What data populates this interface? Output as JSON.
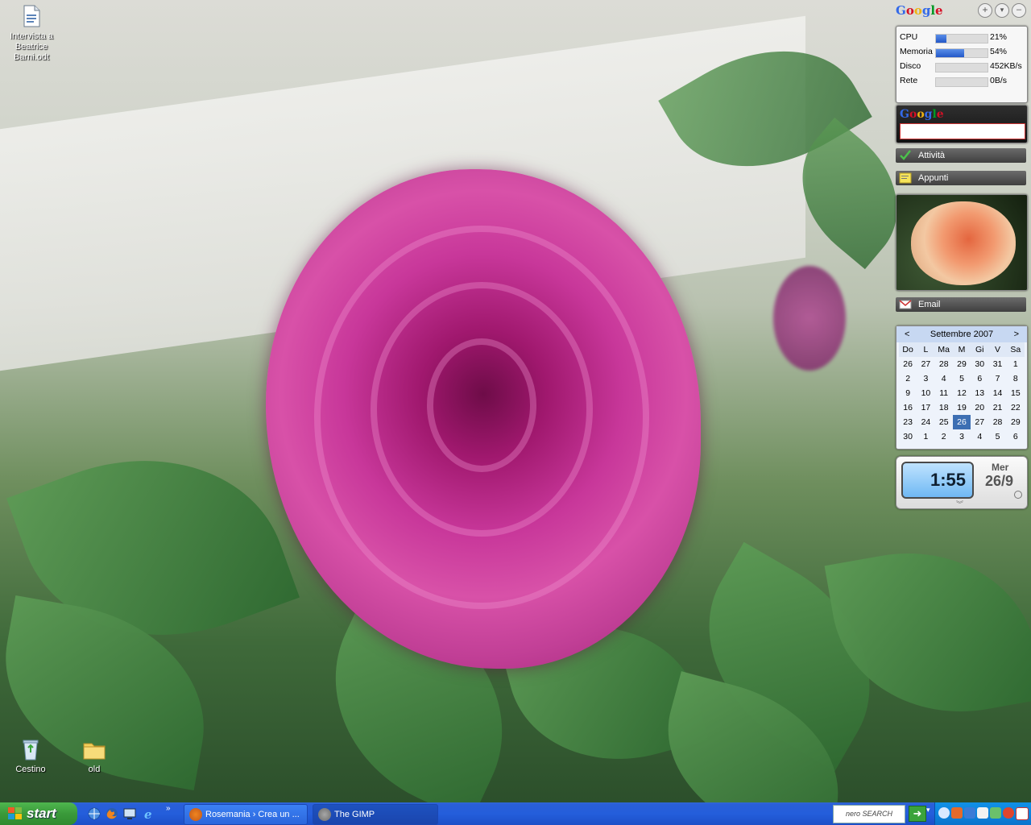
{
  "desktop": {
    "icons": [
      {
        "label": "Intervista a Beatrice Barni.odt"
      },
      {
        "label": "Cestino"
      },
      {
        "label": "old"
      }
    ]
  },
  "sidebar": {
    "brand": "Google",
    "performance": {
      "rows": [
        {
          "name": "CPU",
          "value": "21%",
          "fraction": 0.21
        },
        {
          "name": "Memoria",
          "value": "54%",
          "fraction": 0.54
        },
        {
          "name": "Disco",
          "value": "452KB/s",
          "fraction": 0.0
        },
        {
          "name": "Rete",
          "value": "0B/s",
          "fraction": 0.0
        }
      ]
    },
    "search": {
      "brand": "Google",
      "placeholder": ""
    },
    "activities_label": "Attività",
    "notes_label": "Appunti",
    "email_label": "Email",
    "calendar": {
      "month_label": "Settembre 2007",
      "prev": "<",
      "next": ">",
      "weekdays": [
        "Do",
        "L",
        "Ma",
        "M",
        "Gi",
        "V",
        "Sa"
      ],
      "weeks": [
        [
          "26",
          "27",
          "28",
          "29",
          "30",
          "31",
          "1"
        ],
        [
          "2",
          "3",
          "4",
          "5",
          "6",
          "7",
          "8"
        ],
        [
          "9",
          "10",
          "11",
          "12",
          "13",
          "14",
          "15"
        ],
        [
          "16",
          "17",
          "18",
          "19",
          "20",
          "21",
          "22"
        ],
        [
          "23",
          "24",
          "25",
          "26",
          "27",
          "28",
          "29"
        ],
        [
          "30",
          "1",
          "2",
          "3",
          "4",
          "5",
          "6"
        ]
      ],
      "today": "26"
    },
    "clock": {
      "time": "1:55",
      "weekday": "Mer",
      "date": "26/9"
    }
  },
  "taskbar": {
    "start_label": "start",
    "tasks": [
      {
        "label": "Rosemania › Crea un ..."
      },
      {
        "label": "The GIMP"
      }
    ],
    "search_brand": "nero SEARCH"
  },
  "colors": {
    "taskbar_blue": "#245edb",
    "start_green": "#3a9a3a",
    "calendar_today": "#3d6fb3"
  }
}
